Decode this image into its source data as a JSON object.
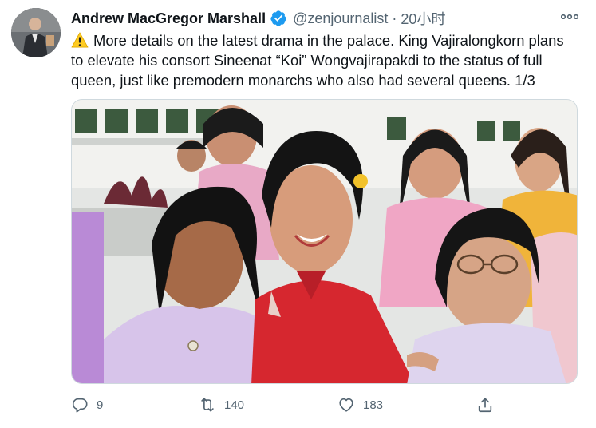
{
  "tweet": {
    "author": {
      "display_name": "Andrew MacGregor Marshall",
      "verified": true,
      "handle": "@zenjournalist",
      "time": "20小时"
    },
    "text_lines": [
      "More details on the latest drama in the palace. King Vajiralongkorn plans",
      "to elevate his consort Sineenat “Koi” Wongvajirapakdi to the status of full",
      "queen, just like premodern monarchs who also had several queens. 1/3"
    ],
    "actions": {
      "reply_count": "9",
      "retweet_count": "140",
      "like_count": "183"
    }
  },
  "icons": {
    "verified": "verified-badge-icon",
    "more": "more-horizontal-icon",
    "warning": "warning-emoji-icon",
    "reply": "reply-icon",
    "retweet": "retweet-icon",
    "like": "heart-icon",
    "share": "share-icon"
  },
  "colors": {
    "verified_blue": "#1d9bf0",
    "secondary_text": "#536471",
    "primary_text": "#0f1419"
  }
}
